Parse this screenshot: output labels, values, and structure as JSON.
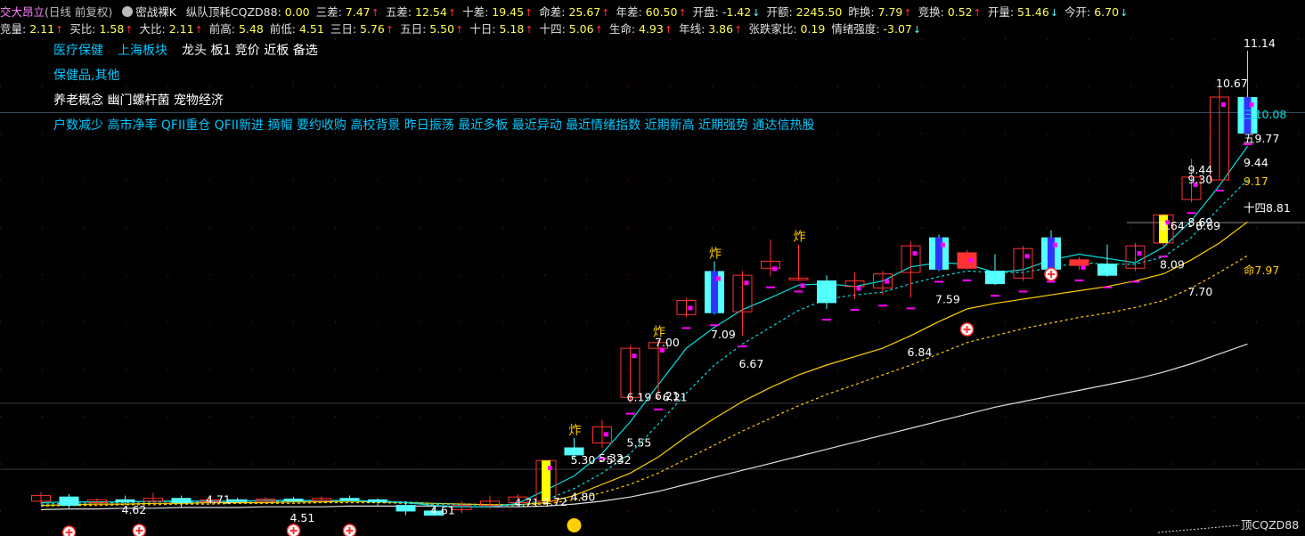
{
  "stock": {
    "name": "交大昂立",
    "period": "(日线 前复权)"
  },
  "indicator": {
    "name": "密战裸K",
    "items": [
      {
        "label": "纵队顶耗CQZD88",
        "value": "0.00",
        "arrow": ""
      },
      {
        "label": "三差",
        "value": "7.47",
        "arrow": "↑"
      },
      {
        "label": "五差",
        "value": "12.54",
        "arrow": "↑"
      },
      {
        "label": "十差",
        "value": "19.45",
        "arrow": "↑"
      },
      {
        "label": "命差",
        "value": "25.67",
        "arrow": "↑"
      },
      {
        "label": "年差",
        "value": "60.50",
        "arrow": "↑"
      },
      {
        "label": "开盘",
        "value": "-1.42",
        "arrow": "↓"
      },
      {
        "label": "开额",
        "value": "2245.50",
        "arrow": ""
      },
      {
        "label": "昨换",
        "value": "7.79",
        "arrow": "↑"
      },
      {
        "label": "竞换",
        "value": "0.52",
        "arrow": "↑"
      },
      {
        "label": "开量",
        "value": "51.46",
        "arrow": "↓"
      },
      {
        "label": "今开",
        "value": "6.70",
        "arrow": "↓"
      }
    ],
    "items2": [
      {
        "label": "竞量",
        "value": "2.11",
        "arrow": "↑"
      },
      {
        "label": "买比",
        "value": "1.58",
        "arrow": "↑"
      },
      {
        "label": "大比",
        "value": "2.11",
        "arrow": "↑"
      },
      {
        "label": "前高",
        "value": "5.48",
        "arrow": ""
      },
      {
        "label": "前低",
        "value": "4.51",
        "arrow": ""
      },
      {
        "label": "三日",
        "value": "5.76",
        "arrow": "↑"
      },
      {
        "label": "五日",
        "value": "5.50",
        "arrow": "↑"
      },
      {
        "label": "十日",
        "value": "5.18",
        "arrow": "↑"
      },
      {
        "label": "十四",
        "value": "5.06",
        "arrow": "↑"
      },
      {
        "label": "生命",
        "value": "4.93",
        "arrow": "↑"
      },
      {
        "label": "年线",
        "value": "3.86",
        "arrow": "↑"
      },
      {
        "label": "张跌家比",
        "value": "0.19",
        "arrow": ""
      },
      {
        "label": "情绪强度",
        "value": "-3.07",
        "arrow": "↓"
      }
    ]
  },
  "tags": {
    "sector1": "医疗保健",
    "sector2": "上海板块",
    "status": "龙头 板1 竞价 近板 备选",
    "industry": "保健品,其他",
    "concepts": "养老概念 幽门螺杆菌 宠物经济",
    "signals": "户数减少 高市净率 QFII重仓 QFII新进 摘帽 要约收购 高校背景 昨日振荡 最近多板 最近异动 最近情绪指数 近期新高 近期强势 通达信热股"
  },
  "colors": {
    "up": "#ff3232",
    "down": "#3232ff",
    "cyan": "#54ffff",
    "yellow": "#ffff00",
    "magenta": "#ff00ff",
    "ma_cyan": "#00e0e0",
    "ma_yellow": "#ffd000",
    "ma_life": "#e0e0e0",
    "label_text": "#ffffff",
    "tag_cyan": "#00c8ff"
  },
  "chart_data": {
    "type": "candlestick",
    "ylim": [
      4.3,
      11.5
    ],
    "candles": [
      {
        "o": 4.72,
        "c": 4.8,
        "h": 4.85,
        "l": 4.68,
        "t": "up"
      },
      {
        "o": 4.78,
        "c": 4.66,
        "h": 4.82,
        "l": 4.62,
        "t": "cyan"
      },
      {
        "o": 4.7,
        "c": 4.74,
        "h": 4.76,
        "l": 4.66,
        "t": "up"
      },
      {
        "o": 4.74,
        "c": 4.72,
        "h": 4.8,
        "l": 4.68,
        "t": "cyan"
      },
      {
        "o": 4.72,
        "c": 4.76,
        "h": 4.84,
        "l": 4.7,
        "t": "up"
      },
      {
        "o": 4.76,
        "c": 4.7,
        "h": 4.8,
        "l": 4.62,
        "t": "cyan"
      },
      {
        "o": 4.71,
        "c": 4.74,
        "h": 4.78,
        "l": 4.69,
        "t": "up"
      },
      {
        "o": 4.74,
        "c": 4.72,
        "h": 4.77,
        "l": 4.7,
        "t": "cyan"
      },
      {
        "o": 4.72,
        "c": 4.75,
        "h": 4.78,
        "l": 4.7,
        "t": "up"
      },
      {
        "o": 4.75,
        "c": 4.73,
        "h": 4.78,
        "l": 4.71,
        "t": "cyan"
      },
      {
        "o": 4.73,
        "c": 4.76,
        "h": 4.79,
        "l": 4.71,
        "t": "up"
      },
      {
        "o": 4.76,
        "c": 4.74,
        "h": 4.8,
        "l": 4.72,
        "t": "cyan"
      },
      {
        "o": 4.74,
        "c": 4.71,
        "h": 4.76,
        "l": 4.66,
        "t": "cyan"
      },
      {
        "o": 4.66,
        "c": 4.58,
        "h": 4.71,
        "l": 4.52,
        "t": "cyan"
      },
      {
        "o": 4.58,
        "c": 4.52,
        "h": 4.62,
        "l": 4.51,
        "t": "cyan"
      },
      {
        "o": 4.6,
        "c": 4.66,
        "h": 4.72,
        "l": 4.55,
        "t": "up"
      },
      {
        "o": 4.66,
        "c": 4.72,
        "h": 4.8,
        "l": 4.61,
        "t": "up"
      },
      {
        "o": 4.7,
        "c": 4.78,
        "h": 4.82,
        "l": 4.68,
        "t": "up"
      },
      {
        "o": 4.72,
        "c": 5.3,
        "h": 5.3,
        "l": 4.72,
        "t": "yellow"
      },
      {
        "o": 5.48,
        "c": 5.38,
        "h": 5.62,
        "l": 5.32,
        "t": "cyan"
      },
      {
        "o": 5.55,
        "c": 5.78,
        "h": 5.88,
        "l": 5.48,
        "t": "up"
      },
      {
        "o": 6.2,
        "c": 6.9,
        "h": 6.94,
        "l": 6.12,
        "t": "up"
      },
      {
        "o": 6.9,
        "c": 6.98,
        "h": 7.02,
        "l": 6.18,
        "t": "up"
      },
      {
        "o": 7.38,
        "c": 7.58,
        "h": 7.62,
        "l": 7.34,
        "t": "up"
      },
      {
        "o": 8.0,
        "c": 7.4,
        "h": 8.14,
        "l": 7.38,
        "t": "down"
      },
      {
        "o": 7.42,
        "c": 7.94,
        "h": 8.0,
        "l": 7.08,
        "t": "up"
      },
      {
        "o": 8.04,
        "c": 8.14,
        "h": 8.45,
        "l": 7.92,
        "t": "up"
      },
      {
        "o": 7.9,
        "c": 7.88,
        "h": 8.38,
        "l": 7.86,
        "t": "up"
      },
      {
        "o": 7.86,
        "c": 7.55,
        "h": 7.94,
        "l": 7.46,
        "t": "cyan"
      },
      {
        "o": 7.78,
        "c": 7.86,
        "h": 7.98,
        "l": 7.6,
        "t": "up"
      },
      {
        "o": 7.76,
        "c": 7.96,
        "h": 8.0,
        "l": 7.66,
        "t": "up"
      },
      {
        "o": 7.98,
        "c": 8.36,
        "h": 8.42,
        "l": 7.62,
        "t": "up"
      },
      {
        "o": 8.48,
        "c": 8.02,
        "h": 8.52,
        "l": 8.0,
        "t": "down"
      },
      {
        "o": 8.26,
        "c": 8.04,
        "h": 8.3,
        "l": 8.02,
        "t": "red"
      },
      {
        "o": 8.0,
        "c": 7.82,
        "h": 8.24,
        "l": 7.8,
        "t": "cyan"
      },
      {
        "o": 7.9,
        "c": 8.32,
        "h": 8.36,
        "l": 7.86,
        "t": "up"
      },
      {
        "o": 8.48,
        "c": 8.02,
        "h": 8.58,
        "l": 8.0,
        "t": "down"
      },
      {
        "o": 8.08,
        "c": 8.16,
        "h": 8.2,
        "l": 8.02,
        "t": "red"
      },
      {
        "o": 8.1,
        "c": 7.94,
        "h": 8.38,
        "l": 7.92,
        "t": "cyan"
      },
      {
        "o": 8.04,
        "c": 8.36,
        "h": 8.4,
        "l": 8.0,
        "t": "up"
      },
      {
        "o": 8.8,
        "c": 8.4,
        "h": 8.82,
        "l": 8.36,
        "t": "yellow"
      },
      {
        "o": 9.02,
        "c": 9.34,
        "h": 9.6,
        "l": 8.98,
        "t": "up"
      },
      {
        "o": 9.3,
        "c": 10.48,
        "h": 10.67,
        "l": 9.3,
        "t": "up"
      },
      {
        "o": 10.48,
        "c": 9.96,
        "h": 11.14,
        "l": 9.96,
        "t": "down"
      }
    ],
    "ma_short": [
      4.7,
      4.71,
      4.71,
      4.71,
      4.72,
      4.72,
      4.72,
      4.72,
      4.73,
      4.73,
      4.73,
      4.73,
      4.72,
      4.7,
      4.66,
      4.64,
      4.64,
      4.69,
      4.88,
      5.08,
      5.4,
      5.85,
      6.38,
      6.9,
      7.2,
      7.45,
      7.62,
      7.8,
      7.82,
      7.78,
      7.86,
      8.06,
      8.12,
      8.1,
      7.98,
      8.02,
      8.16,
      8.24,
      8.18,
      8.12,
      8.34,
      8.72,
      9.22,
      9.78
    ],
    "ma_mid": [
      4.68,
      4.69,
      4.7,
      4.7,
      4.71,
      4.71,
      4.71,
      4.72,
      4.72,
      4.72,
      4.73,
      4.73,
      4.72,
      4.71,
      4.69,
      4.67,
      4.66,
      4.66,
      4.74,
      4.9,
      5.12,
      5.4,
      5.82,
      6.26,
      6.66,
      6.96,
      7.2,
      7.44,
      7.6,
      7.66,
      7.7,
      7.82,
      7.92,
      8.0,
      7.98,
      7.98,
      8.05,
      8.12,
      8.1,
      8.1,
      8.2,
      8.48,
      8.9,
      9.3
    ],
    "ma_ten": [
      4.66,
      4.67,
      4.68,
      4.68,
      4.69,
      4.69,
      4.7,
      4.7,
      4.7,
      4.71,
      4.71,
      4.72,
      4.71,
      4.7,
      4.69,
      4.68,
      4.67,
      4.67,
      4.7,
      4.8,
      4.96,
      5.12,
      5.35,
      5.64,
      5.9,
      6.14,
      6.34,
      6.52,
      6.66,
      6.78,
      6.9,
      7.08,
      7.28,
      7.46,
      7.54,
      7.6,
      7.66,
      7.72,
      7.78,
      7.86,
      7.96,
      8.16,
      8.4,
      8.7
    ],
    "ma_dash": [
      4.65,
      4.66,
      4.66,
      4.67,
      4.67,
      4.68,
      4.68,
      4.69,
      4.69,
      4.69,
      4.7,
      4.7,
      4.7,
      4.69,
      4.68,
      4.68,
      4.67,
      4.67,
      4.68,
      4.74,
      4.84,
      4.96,
      5.12,
      5.32,
      5.52,
      5.72,
      5.9,
      6.08,
      6.24,
      6.38,
      6.52,
      6.66,
      6.82,
      6.98,
      7.08,
      7.18,
      7.26,
      7.34,
      7.4,
      7.48,
      7.58,
      7.76,
      7.98,
      8.22
    ],
    "ma_life": [
      4.6,
      4.61,
      4.61,
      4.62,
      4.62,
      4.63,
      4.63,
      4.63,
      4.64,
      4.64,
      4.64,
      4.65,
      4.65,
      4.65,
      4.65,
      4.64,
      4.64,
      4.64,
      4.65,
      4.68,
      4.72,
      4.78,
      4.86,
      4.96,
      5.06,
      5.16,
      5.26,
      5.36,
      5.46,
      5.56,
      5.66,
      5.76,
      5.86,
      5.96,
      6.06,
      6.14,
      6.22,
      6.3,
      6.38,
      6.46,
      6.56,
      6.68,
      6.82,
      6.96
    ],
    "labels": [
      {
        "i": 6,
        "v": "4.71",
        "dy": -10
      },
      {
        "i": 3,
        "v": "4.62",
        "dy": 10
      },
      {
        "i": 9,
        "v": "4.51",
        "dy": 12
      },
      {
        "i": 14,
        "v": "4.61",
        "dy": 10
      },
      {
        "i": 17,
        "v": "4.71",
        "dy": 6
      },
      {
        "i": 18,
        "v": "4.72",
        "dy": 6
      },
      {
        "i": 19,
        "v": "4.80",
        "dy": 10
      },
      {
        "i": 19,
        "v": "5.30 - 5.32",
        "dy": -2
      },
      {
        "i": 20,
        "v": "5.32",
        "dy": -2
      },
      {
        "i": 21,
        "v": "5.55",
        "dy": 0
      },
      {
        "i": 21,
        "v": "6.19 - 6.21",
        "dy": -2
      },
      {
        "i": 22,
        "v": "6.21",
        "dy": -2
      },
      {
        "i": 22,
        "v": "7.00",
        "dy": 8
      },
      {
        "i": 24,
        "v": "7.09",
        "dy": 0
      },
      {
        "i": 25,
        "v": "6.67",
        "dy": 0
      },
      {
        "i": 31,
        "v": "6.84",
        "dy": 0
      },
      {
        "i": 32,
        "v": "7.59",
        "dy": 0
      },
      {
        "i": 40,
        "v": "8.09",
        "dy": 0
      },
      {
        "i": 41,
        "v": "7.70",
        "dy": 0
      },
      {
        "i": 40,
        "v": "8.64 - 8.69",
        "dy": 0
      },
      {
        "i": 41,
        "v": "8.69",
        "dy": 0
      },
      {
        "i": 41,
        "v": "9.44",
        "dy": 0
      },
      {
        "i": 41,
        "v": "9.30",
        "dy": 0
      },
      {
        "i": 42,
        "v": "10.67",
        "dy": 0
      }
    ],
    "right_labels": [
      {
        "v": "11.14",
        "prefix": "",
        "kind": "price"
      },
      {
        "v": "10.08",
        "prefix": "三",
        "kind": "ma_short"
      },
      {
        "v": "9.77",
        "prefix": "五",
        "kind": "ma_mid"
      },
      {
        "v": "9.44",
        "prefix": "",
        "kind": "price"
      },
      {
        "v": "9.17",
        "prefix": "",
        "kind": "ma_ten"
      },
      {
        "v": "8.81",
        "prefix": "十四",
        "kind": "ma_dash"
      },
      {
        "v": "7.97",
        "prefix": "命",
        "kind": "ma_life"
      }
    ],
    "bottom_label": "顶CQZD88",
    "boom_label": "炸"
  }
}
